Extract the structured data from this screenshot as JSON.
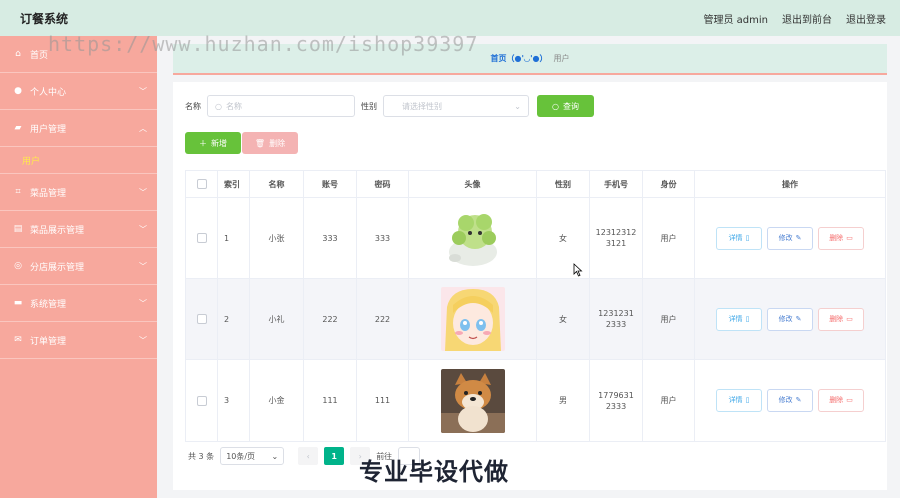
{
  "header": {
    "app_title": "订餐系统",
    "user_label": "管理员 admin",
    "back_to_front": "退出到前台",
    "logout": "退出登录"
  },
  "watermark": "https://www.huzhan.com/ishop39397",
  "sidebar": {
    "items": [
      {
        "label": "首页",
        "icon": "home-icon"
      },
      {
        "label": "个人中心",
        "icon": "user-icon",
        "arrow": "⌄"
      },
      {
        "label": "用户管理",
        "icon": "users-icon",
        "arrow": "⌃"
      },
      {
        "label": "菜品管理",
        "icon": "crop-icon",
        "arrow": "⌄"
      },
      {
        "label": "菜品展示管理",
        "icon": "chart-icon",
        "arrow": "⌄"
      },
      {
        "label": "分店展示管理",
        "icon": "compass-icon",
        "arrow": "⌄"
      },
      {
        "label": "系统管理",
        "icon": "chat-icon",
        "arrow": "⌄"
      },
      {
        "label": "订单管理",
        "icon": "mail-icon",
        "arrow": "⌄"
      }
    ],
    "subitem": "用户"
  },
  "breadcrumb": {
    "home": "首页（●'◡'●）",
    "current": "用户"
  },
  "search": {
    "name_label": "名称",
    "name_placeholder": "名称",
    "sex_label": "性别",
    "sex_placeholder": "请选择性别",
    "search_button": "查询"
  },
  "actions": {
    "add": "新增",
    "delete": "删除"
  },
  "table": {
    "headers": [
      "索引",
      "名称",
      "账号",
      "密码",
      "头像",
      "性别",
      "手机号",
      "身份",
      "操作"
    ],
    "rows": [
      {
        "index": "1",
        "name": "小张",
        "account": "333",
        "password": "333",
        "sex": "女",
        "phone": "12312312 3121",
        "role": "用户"
      },
      {
        "index": "2",
        "name": "小礼",
        "account": "222",
        "password": "222",
        "sex": "女",
        "phone": "1231231 2333",
        "role": "用户"
      },
      {
        "index": "3",
        "name": "小金",
        "account": "111",
        "password": "111",
        "sex": "男",
        "phone": "1779631 2333",
        "role": "用户"
      }
    ],
    "ops": {
      "detail": "详情",
      "edit": "修改",
      "delete": "删除"
    }
  },
  "pagination": {
    "total": "共 3 条",
    "page_size": "10条/页",
    "current_page": "1",
    "goto_label": "前往"
  },
  "overlay_text": "专业毕设代做",
  "colors": {
    "sidebar_bg": "#f7a89d",
    "header_bg": "#d7ece3",
    "primary_green": "#67c23a",
    "active_sub": "#ffe84d",
    "page_active": "#00b38a"
  }
}
